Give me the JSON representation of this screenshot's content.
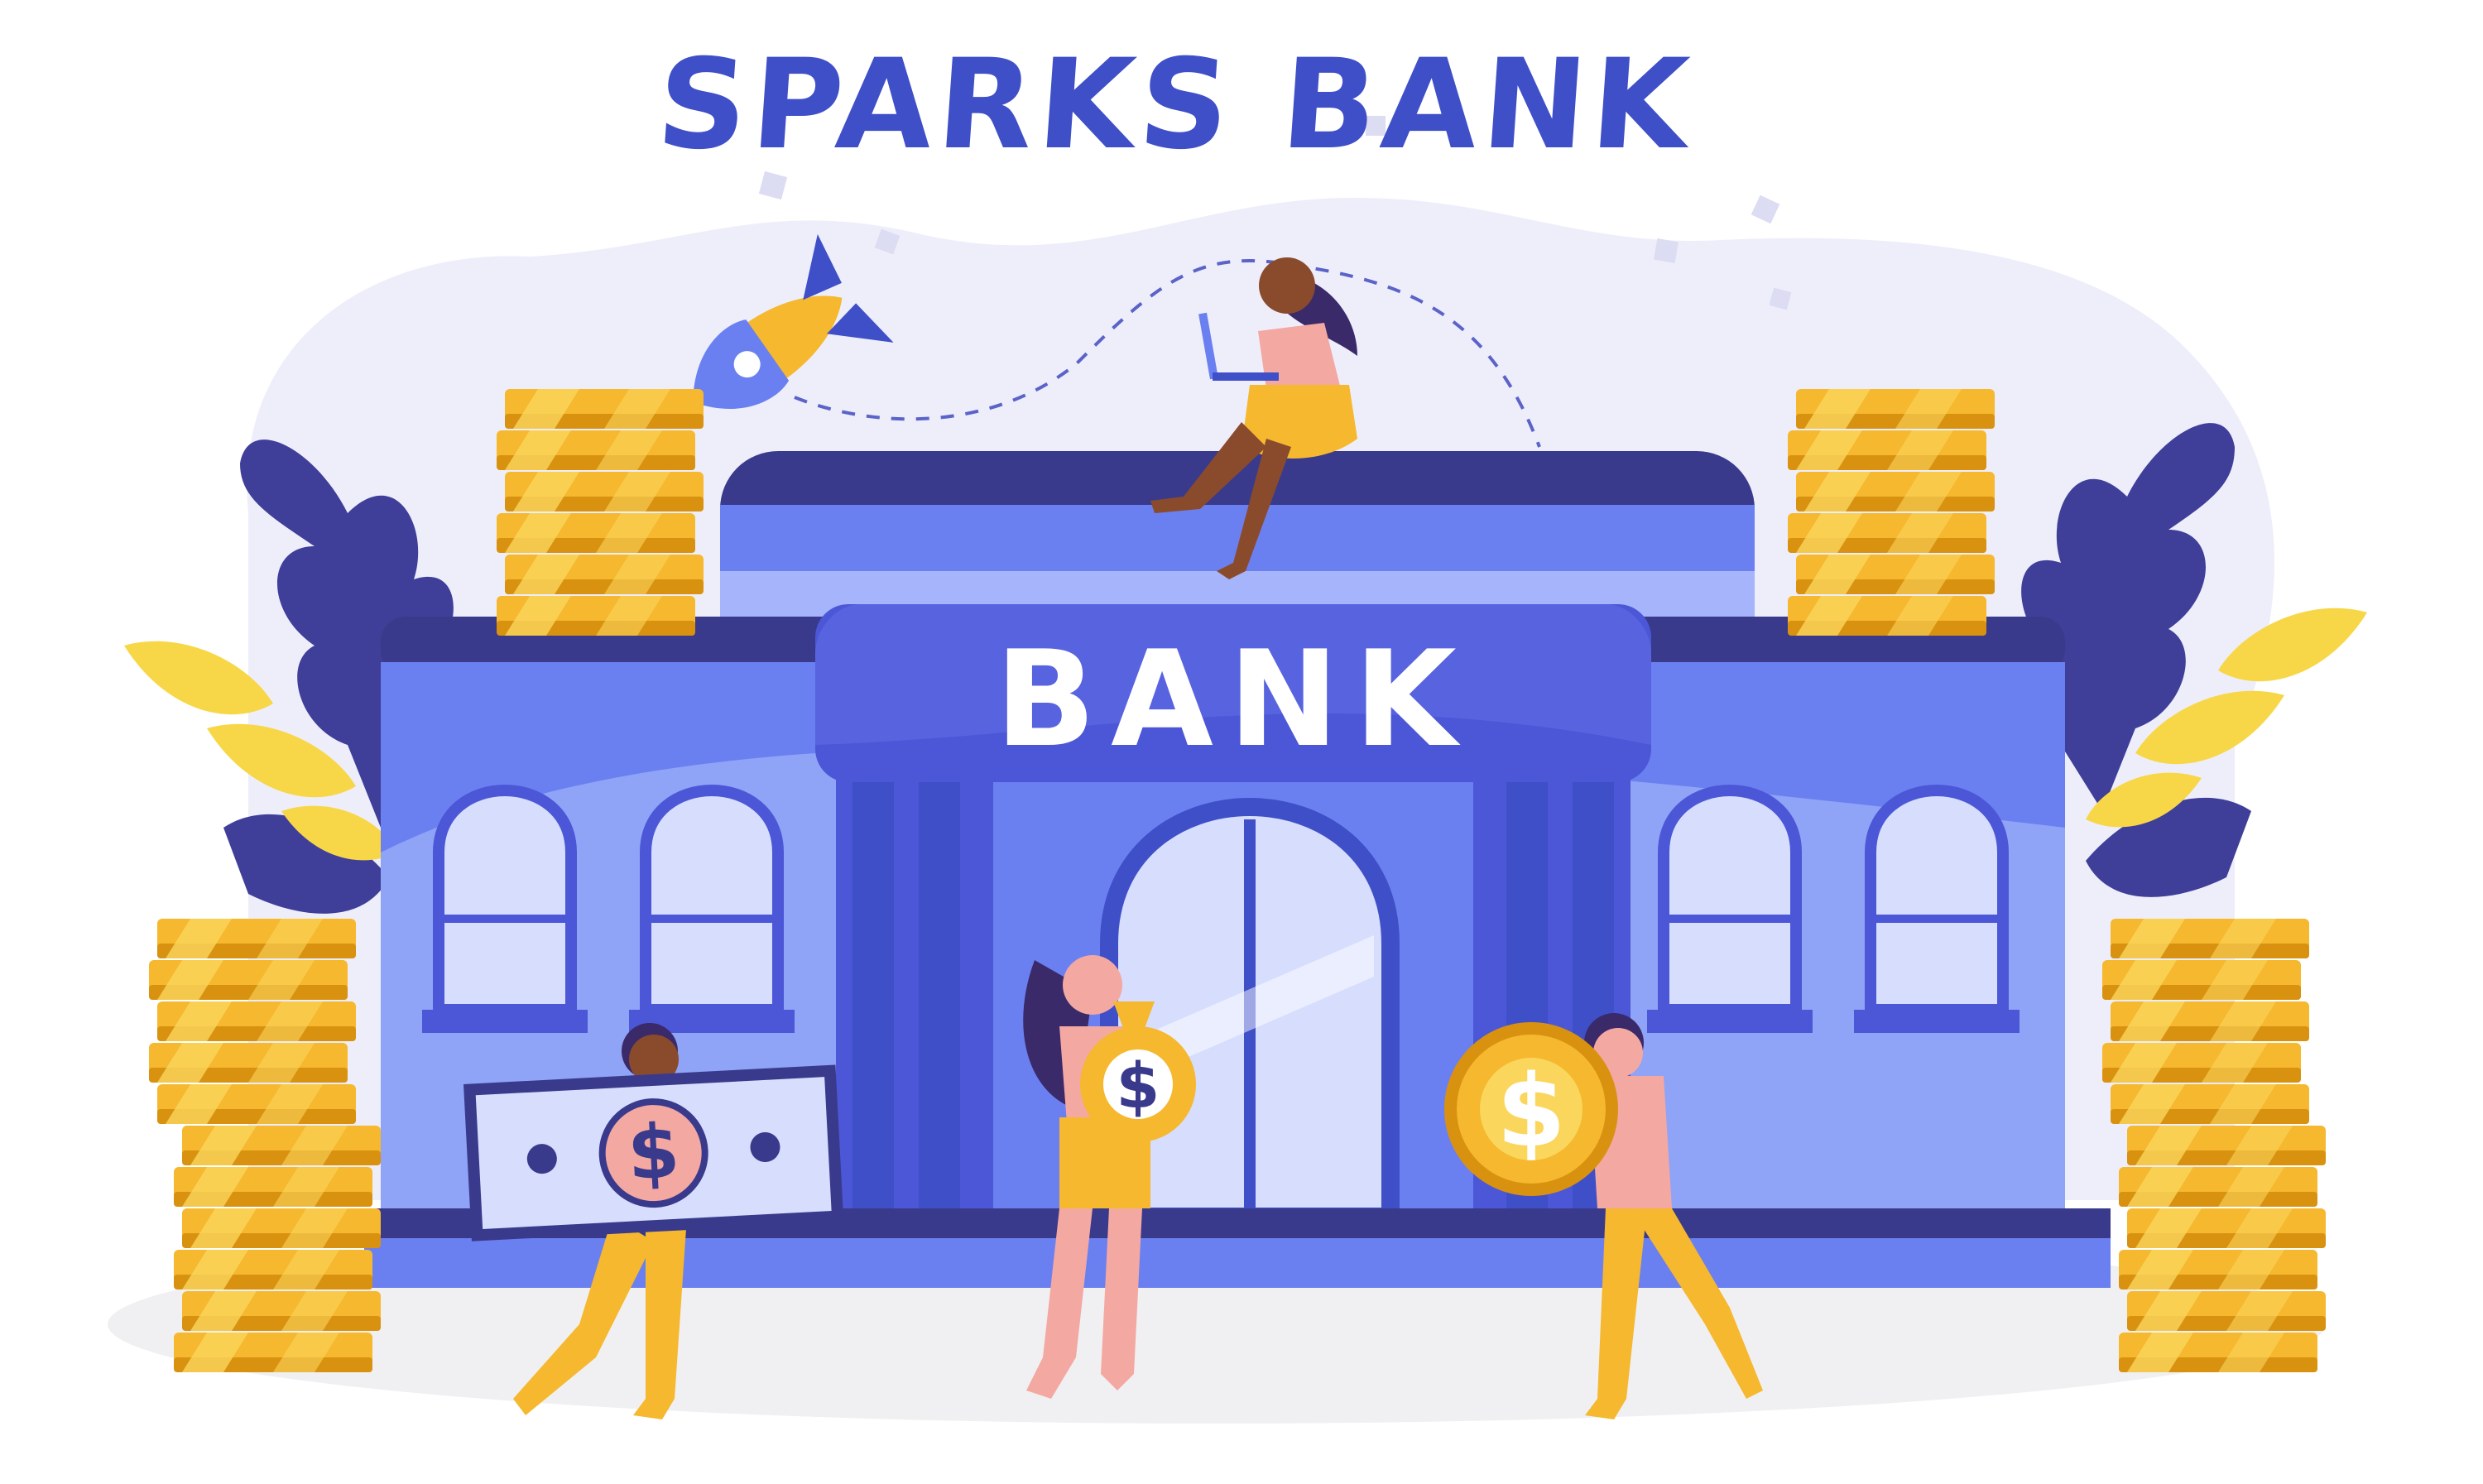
{
  "title": "SPARKS BANK",
  "sign": "BANK",
  "currency_symbol": "$",
  "colors": {
    "brand_blue": "#3f4fc8",
    "building_light": "#8fa3f7",
    "building_mid": "#6b80f0",
    "building_dark": "#3a3a8c",
    "sign_blue": "#4b57d6",
    "gold": "#f5b82e",
    "gold_dark": "#d89210",
    "background_blob": "#eeeefb",
    "leaf_dark": "#3f3f9a",
    "leaf_yellow": "#f7d747"
  },
  "illustration": {
    "people": [
      {
        "name": "woman-with-laptop"
      },
      {
        "name": "man-carrying-banknote"
      },
      {
        "name": "woman-holding-money-bag"
      },
      {
        "name": "man-carrying-gold-coin"
      }
    ],
    "icons": [
      "rocket-icon",
      "banknote-icon",
      "money-bag-icon",
      "gold-coin-icon",
      "coin-stack-icon",
      "leaf-icon"
    ]
  }
}
